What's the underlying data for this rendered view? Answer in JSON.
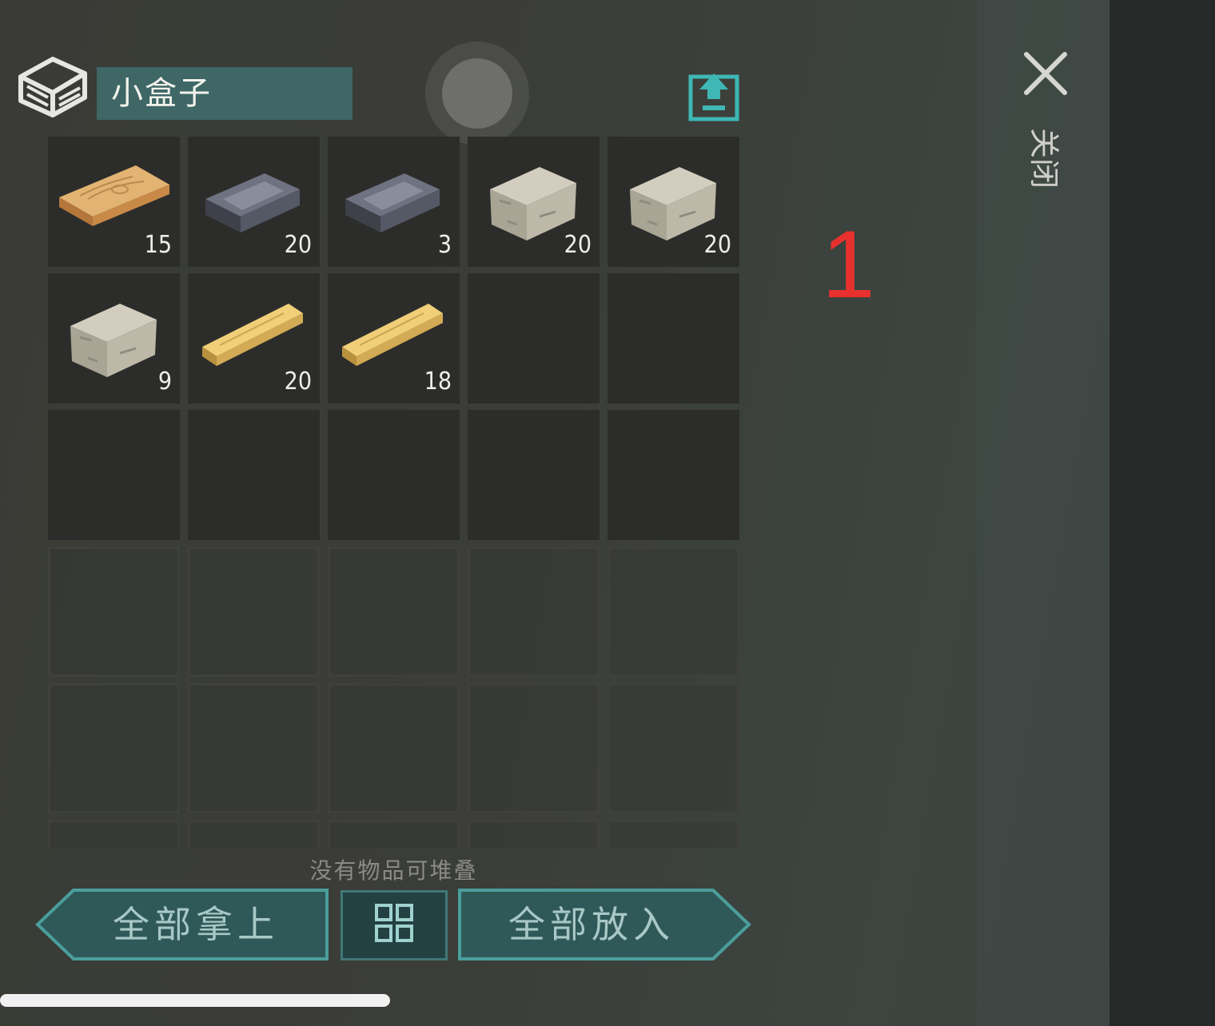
{
  "container": {
    "title": "小盒子",
    "icon": "box-icon",
    "upload_icon": "upload-icon"
  },
  "inventory": {
    "columns": 5,
    "slots": [
      {
        "item": "wood-plank",
        "count": "15"
      },
      {
        "item": "metal-ingot",
        "count": "20"
      },
      {
        "item": "metal-ingot",
        "count": "3"
      },
      {
        "item": "stone-block",
        "count": "20"
      },
      {
        "item": "stone-block",
        "count": "20"
      },
      {
        "item": "stone-block",
        "count": "9"
      },
      {
        "item": "light-plank",
        "count": "20"
      },
      {
        "item": "light-plank",
        "count": "18"
      },
      {
        "item": null,
        "count": ""
      },
      {
        "item": null,
        "count": ""
      }
    ]
  },
  "status": "没有物品可堆叠",
  "buttons": {
    "take_all": "全部拿上",
    "sort_icon": "grid-sort-icon",
    "put_all": "全部放入"
  },
  "close": {
    "label": "关闭",
    "icon": "close-icon"
  },
  "annotation_number": "1",
  "colors": {
    "accent": "#3e6766",
    "button_text": "#a8c8c6",
    "annotation": "#e8312e"
  }
}
